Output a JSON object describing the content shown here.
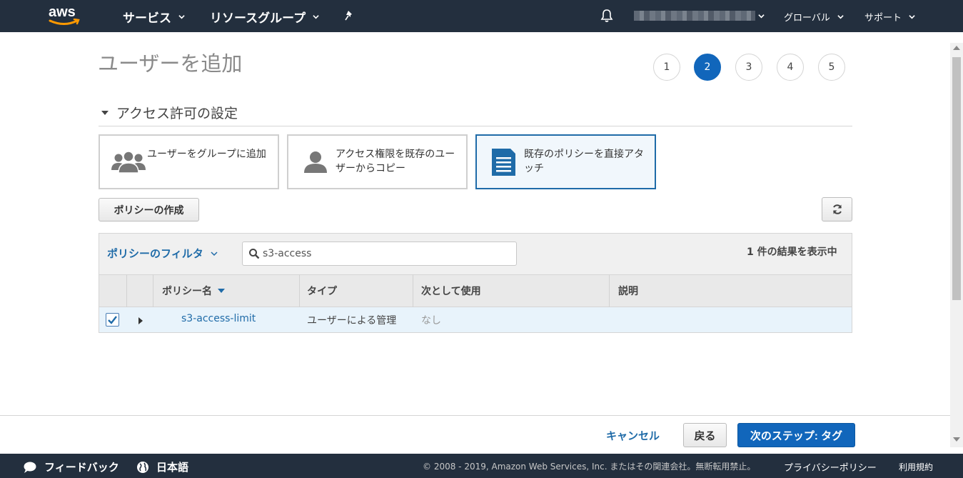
{
  "topnav": {
    "logo": "aws",
    "services": "サービス",
    "resource_groups": "リソースグループ",
    "region": "グローバル",
    "support": "サポート"
  },
  "page": {
    "title": "ユーザーを追加",
    "steps": [
      "1",
      "2",
      "3",
      "4",
      "5"
    ],
    "active_step": "2"
  },
  "permissions": {
    "section_title": "アクセス許可の設定",
    "options": [
      {
        "label": "ユーザーをグループに追加",
        "icon": "users-group-icon"
      },
      {
        "label": "アクセス権限を既存のユーザーからコピー",
        "icon": "user-icon"
      },
      {
        "label": "既存のポリシーを直接アタッチ",
        "icon": "document-icon",
        "selected": true
      }
    ],
    "create_policy_button": "ポリシーの作成",
    "refresh_icon": "refresh-icon"
  },
  "filter": {
    "label": "ポリシーのフィルタ",
    "search_value": "s3-access",
    "result_count": "1 件の結果を表示中"
  },
  "table": {
    "columns": [
      "ポリシー名",
      "タイプ",
      "次として使用",
      "説明"
    ],
    "rows": [
      {
        "name": "s3-access-limit",
        "type": "ユーザーによる管理",
        "used_as": "なし",
        "description": "",
        "checked": true
      }
    ]
  },
  "actions": {
    "cancel": "キャンセル",
    "back": "戻る",
    "next": "次のステップ: タグ"
  },
  "footer": {
    "feedback": "フィードバック",
    "language": "日本語",
    "copyright": "© 2008 - 2019, Amazon Web Services, Inc. またはその関連会社。無断転用禁止。",
    "privacy": "プライバシーポリシー",
    "terms": "利用規約"
  },
  "colors": {
    "nav_bg": "#232f3e",
    "accent": "#1166bb",
    "link": "#1f6ba8",
    "selected_row": "#e8f3fb"
  }
}
